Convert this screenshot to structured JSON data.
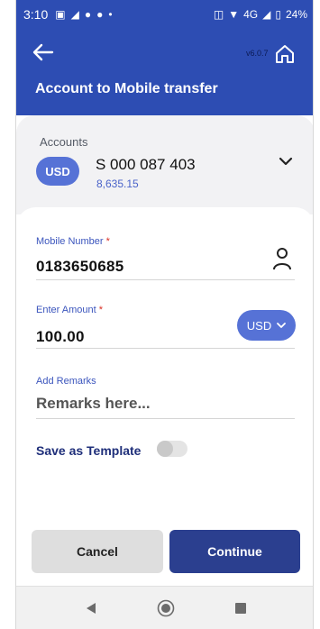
{
  "status_bar": {
    "time": "3:10",
    "network": "4G",
    "battery": "24%",
    "icons": [
      "gallery-icon",
      "telegram-icon",
      "facebook-icon",
      "facebook-icon",
      "dot-icon",
      "vibrate-icon",
      "wifi-icon",
      "signal-icon",
      "battery-icon"
    ]
  },
  "header": {
    "title": "Account to Mobile transfer",
    "version": "v6.0.7",
    "back_icon": "arrow-left-icon",
    "home_icon": "home-icon"
  },
  "accounts": {
    "label": "Accounts",
    "currency": "USD",
    "account_number": "S 000 087 403",
    "balance": "8,635.15"
  },
  "form": {
    "mobile_label": "Mobile Number",
    "mobile_value": "0183650685",
    "amount_label": "Enter Amount",
    "amount_value": "100.00",
    "amount_currency": "USD",
    "remarks_label": "Add Remarks",
    "remarks_placeholder": "Remarks here...",
    "save_template_label": "Save as Template",
    "save_template_on": false,
    "required_mark": "*"
  },
  "actions": {
    "cancel_label": "Cancel",
    "continue_label": "Continue"
  },
  "colors": {
    "primary": "#2d4db3",
    "pill": "#5672d6",
    "continue_button": "#2b3f8f",
    "label_blue": "#3b55bd"
  }
}
